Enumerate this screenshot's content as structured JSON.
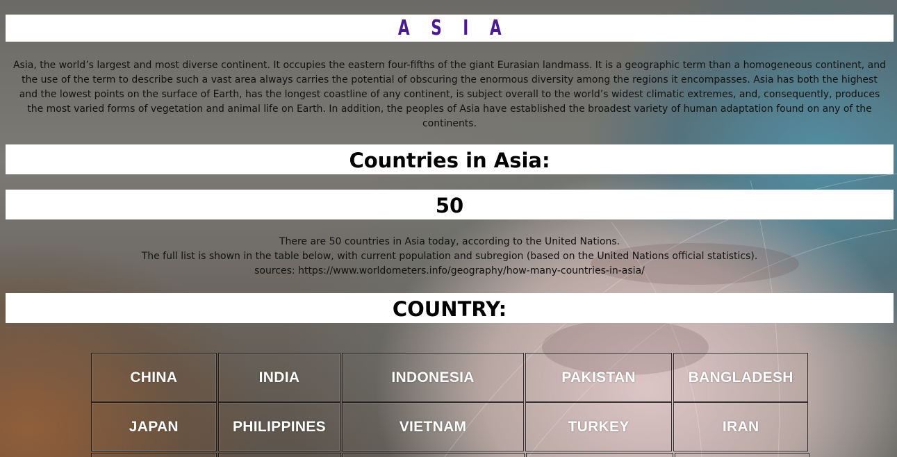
{
  "title": "A S I A",
  "intro": "Asia, the world’s largest and most diverse continent. It occupies the eastern four-fifths of the giant Eurasian landmass. It is a geographic term than a homogeneous continent, and the use of the term to describe such a vast area always carries the potential of obscuring the enormous diversity among the regions it encompasses. Asia has both the highest and the lowest points on the surface of Earth, has the longest coastline of any continent, is subject overall to the world’s widest climatic extremes, and, consequently, produces the most varied forms of vegetation and animal life on Earth. In addition, the peoples of Asia have established the broadest variety of human adaptation found on any of the continents.",
  "countries_heading": "Countries in Asia:",
  "count": "50",
  "info": {
    "line1": "There are 50 countries in Asia today, according to the United Nations.",
    "line2": "The full list is shown in the table below, with current population and subregion (based on the United Nations official statistics).",
    "line3": "sources: https://www.worldometers.info/geography/how-many-countries-in-asia/"
  },
  "country_heading": "COUNTRY:",
  "countries": [
    [
      "CHINA",
      "INDIA",
      "INDONESIA",
      "PAKISTAN",
      "BANGLADESH"
    ],
    [
      "JAPAN",
      "PHILIPPINES",
      "VIETNAM",
      "TURKEY",
      "IRAN"
    ]
  ],
  "background": {
    "description_icon": "globe-background"
  }
}
